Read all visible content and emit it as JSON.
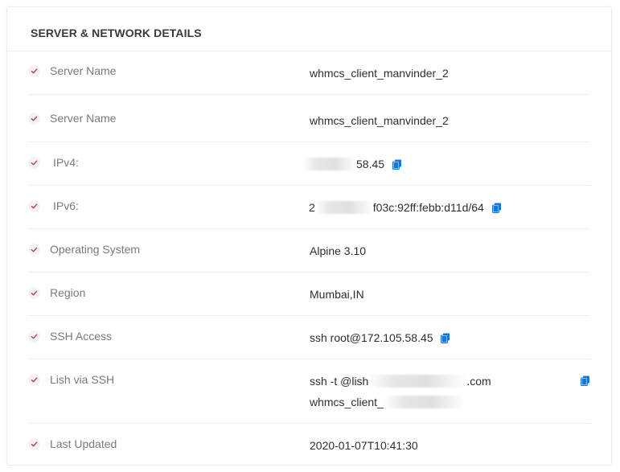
{
  "card": {
    "title": "SERVER & NETWORK DETAILS"
  },
  "rows": [
    {
      "label": "Server Name",
      "value": "whmcs_client_manvinder_2"
    },
    {
      "label": "Server Name",
      "value": "whmcs_client_manvinder_2"
    },
    {
      "label": "IPv4:",
      "value_suffix": "58.45"
    },
    {
      "label": "IPv6:",
      "value_prefix": "2",
      "value_suffix": "f03c:92ff:febb:d11d/64"
    },
    {
      "label": "Operating System",
      "value": "Alpine 3.10"
    },
    {
      "label": "Region",
      "value": "Mumbai,IN"
    },
    {
      "label": "SSH Access",
      "value": "ssh root@172.105.58.45"
    },
    {
      "label": "Lish via SSH",
      "value_line1_prefix": "ssh -t @lish",
      "value_line1_suffix": ".com",
      "value_line2_prefix": "whmcs_client_"
    },
    {
      "label": "Last Updated",
      "value": "2020-01-07T10:41:30"
    }
  ],
  "icons": {
    "check": "check-icon",
    "copy": "copy-icon"
  },
  "colors": {
    "check": "#b5485b",
    "copy": "#1976d2"
  }
}
